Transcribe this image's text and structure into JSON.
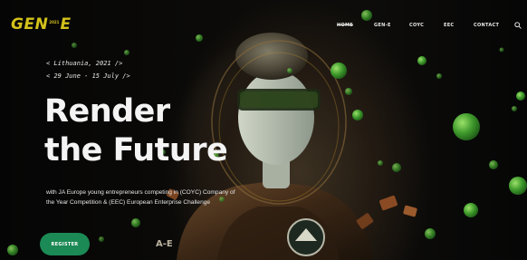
{
  "brand": {
    "logo_main": "GEN",
    "logo_year": "2021",
    "logo_suffix": "E"
  },
  "nav": {
    "items": [
      {
        "label": "HOME",
        "active": true
      },
      {
        "label": "GEN-E",
        "active": false
      },
      {
        "label": "COYC",
        "active": false
      },
      {
        "label": "EEC",
        "active": false
      },
      {
        "label": "CONTACT",
        "active": false
      }
    ],
    "search_icon": "search-icon"
  },
  "hero": {
    "location": "< Lithuania, 2021 />",
    "dates": "< 29 June - 15 July />",
    "headline_line1": "Render",
    "headline_line2": "the Future",
    "description": "with JA Europe young entrepreneurs competing in (COYC) Company of the Year Competition & (EEC) European Enterprise Challenge",
    "register_label": "REGISTER",
    "suit_text": "A-E"
  },
  "colors": {
    "logo": "#d4c21a",
    "accent_green": "#1c8a55",
    "bubble_green": "#4fae3c",
    "text": "#f4f4f4",
    "background": "#0a0a0a"
  }
}
